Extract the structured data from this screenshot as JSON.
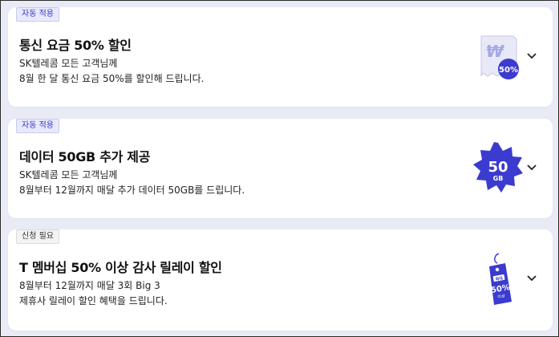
{
  "benefits": [
    {
      "badge": "자동 적용",
      "title": "통신 요금 50% 할인",
      "desc_line1": "SK텔레콤 모든 고객님께",
      "desc_line2": "8월 한 달 통신 요금 50%를 할인해 드립니다.",
      "icon_text": "50%",
      "icon_symbol": "₩"
    },
    {
      "badge": "자동 적용",
      "title": "데이터 50GB 추가 제공",
      "desc_line1": "SK텔레콤 모든 고객님께",
      "desc_line2": "8월부터 12월까지 매달 추가 데이터 50GB를 드립니다.",
      "icon_text": "50",
      "icon_subtext": "GB"
    },
    {
      "badge": "신청 필요",
      "title": "T 멤버십 50% 이상 감사 릴레이 할인",
      "desc_line1": "8월부터 12월까지 매달 3회 Big 3",
      "desc_line2": "제휴사 릴레이 할인 혜택을 드립니다.",
      "icon_tag_top": "최대",
      "icon_text": "50%",
      "icon_subtext": "이상"
    }
  ],
  "colors": {
    "accent": "#3b3bd0",
    "badge_auto_bg": "#e9e9fb",
    "page_bg": "#e8ebf5"
  }
}
